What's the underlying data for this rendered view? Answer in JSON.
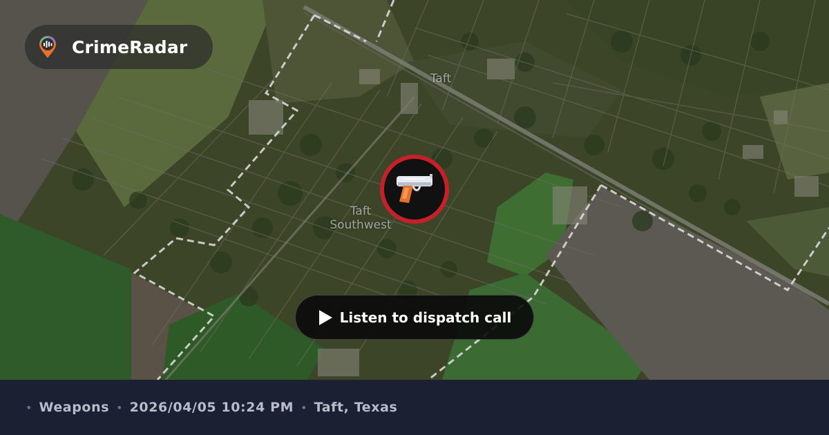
{
  "brand": {
    "name": "CrimeRadar",
    "icon": "radar-pin-icon"
  },
  "map": {
    "labels": {
      "town": "Taft",
      "area_line1": "Taft",
      "area_line2": "Southwest"
    }
  },
  "incident": {
    "icon": "pistol-icon",
    "ring_color": "#c8202a"
  },
  "actions": {
    "listen_label": "Listen to dispatch call",
    "play_icon": "play-icon"
  },
  "footer": {
    "bullet": "•",
    "category": "Weapons",
    "datetime": "2026/04/05 10:24 PM",
    "location": "Taft, Texas"
  }
}
